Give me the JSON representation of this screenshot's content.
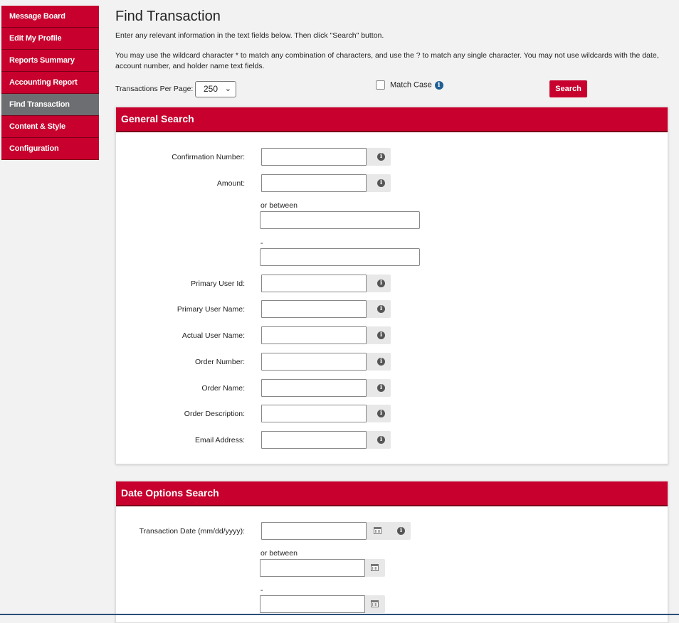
{
  "sidebar": {
    "items": [
      {
        "label": "Message Board"
      },
      {
        "label": "Edit My Profile"
      },
      {
        "label": "Reports Summary"
      },
      {
        "label": "Accounting Report"
      },
      {
        "label": "Find Transaction",
        "active": true
      },
      {
        "label": "Content & Style"
      },
      {
        "label": "Configuration"
      }
    ]
  },
  "main": {
    "title": "Find Transaction",
    "intro": "Enter any relevant information in the text fields below. Then click \"Search\" button.",
    "wildcard_line1": "You may use the wildcard character * to match any combination of characters, and use the ? to match any single character. You may not use wildcards with the date,",
    "wildcard_line2": "account number, and holder name text fields.",
    "transactions_per_page_label": "Transactions Per Page:",
    "transactions_per_page_value": "250",
    "match_case_label": "Match Case",
    "search_label": "Search"
  },
  "general_search": {
    "header": "General Search",
    "confirmation_number": "Confirmation Number:",
    "amount": "Amount:",
    "or_between": "or between",
    "dash": "-",
    "primary_user_id": "Primary User Id:",
    "primary_user_name": "Primary User Name:",
    "actual_user_name": "Actual User Name:",
    "order_number": "Order Number:",
    "order_name": "Order Name:",
    "order_description": "Order Description:",
    "email_address": "Email Address:"
  },
  "date_search": {
    "header": "Date Options Search",
    "transaction_date": "Transaction Date (mm/dd/yyyy):",
    "or_between": "or between",
    "dash": "-"
  },
  "icons": {
    "info": "i",
    "caret": "⌄"
  },
  "colors": {
    "brand_red": "#c8002d",
    "active_grey": "#6d6e71"
  }
}
